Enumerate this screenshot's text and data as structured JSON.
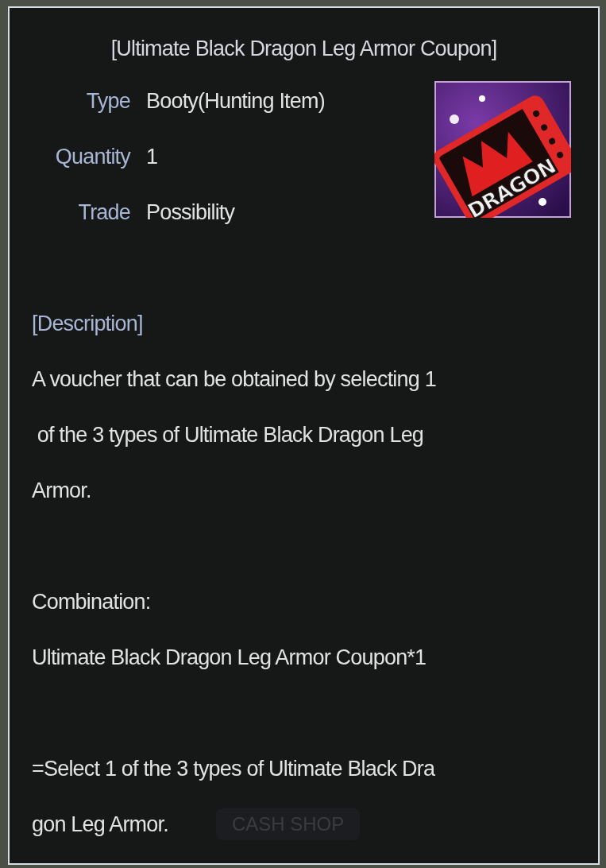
{
  "tooltip": {
    "title": "[Ultimate Black Dragon Leg Armor Coupon]",
    "item_icon": {
      "label": "DRAGON"
    },
    "properties": [
      {
        "label": "Type",
        "value": "Booty(Hunting Item)"
      },
      {
        "label": "Quantity",
        "value": "1"
      },
      {
        "label": "Trade",
        "value": "Possibility"
      }
    ],
    "description_heading": "[Description]",
    "paragraphs": [
      [
        "A voucher that can be obtained by selecting 1",
        " of the 3 types of Ultimate Black Dragon Leg",
        "Armor."
      ],
      [
        "Combination:",
        "Ultimate Black Dragon Leg Armor Coupon*1"
      ],
      [
        "=Select 1 of the 3 types of Ultimate Black Dra",
        "gon Leg Armor."
      ]
    ]
  },
  "background": {
    "button": "CASH SHOP"
  }
}
